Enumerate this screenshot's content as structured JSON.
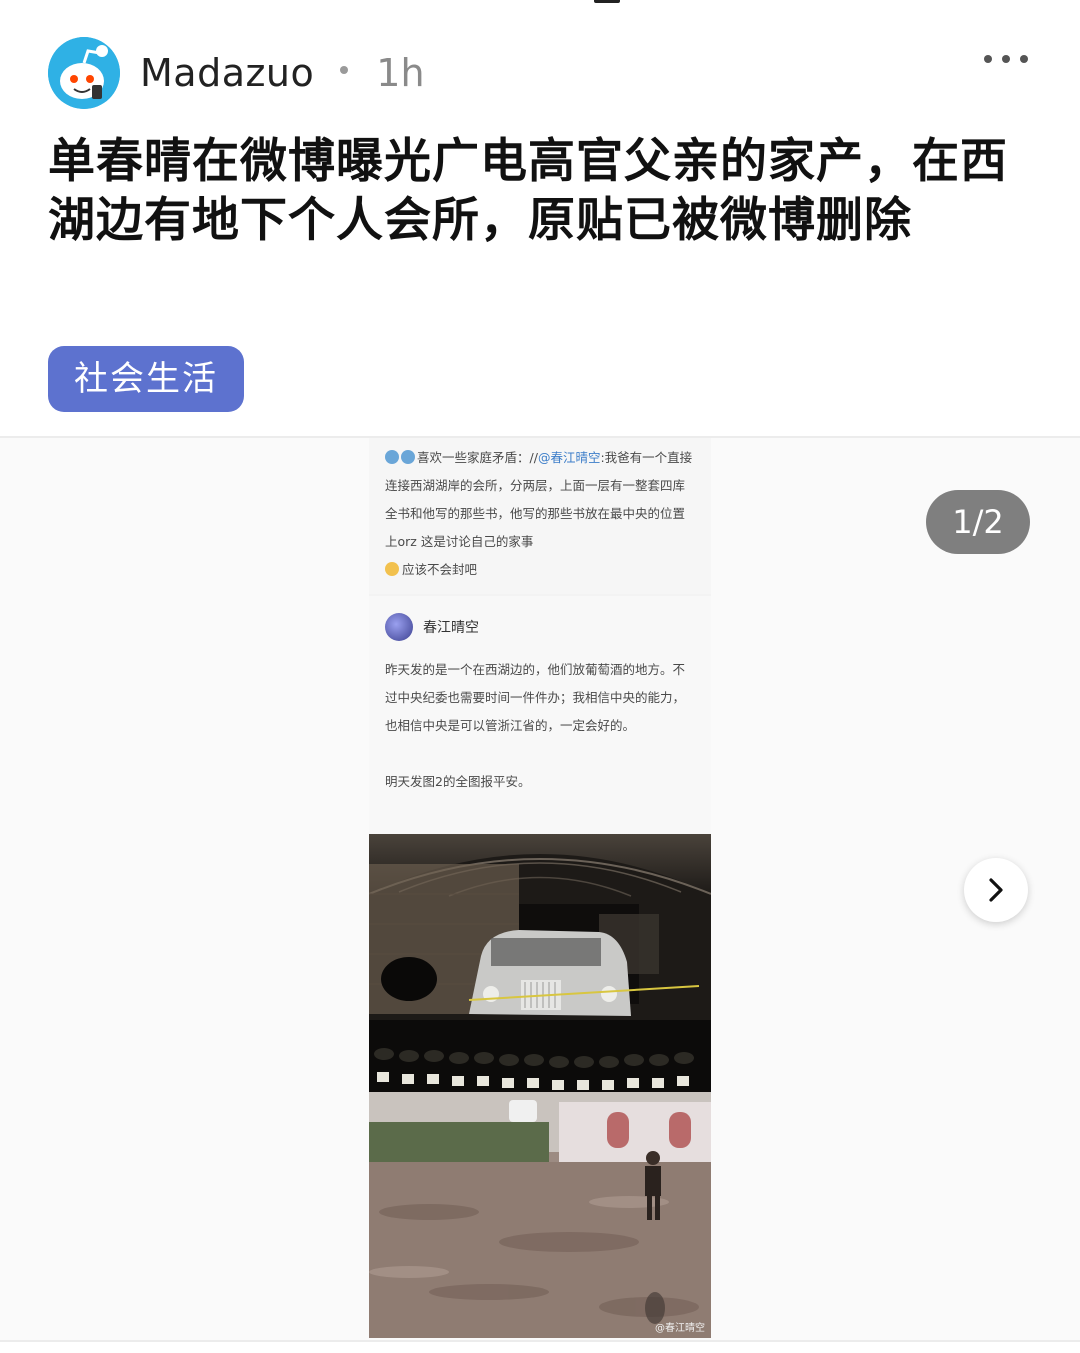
{
  "post": {
    "author": "Madazuo",
    "time": "1h",
    "title": "单春晴在微博曝光广电高官父亲的家产，在西湖边有地下个人会所，原贴已被微博删除",
    "flair": "社会生活",
    "colors": {
      "flair_bg": "#5d72cf",
      "avatar_bg": "#2fb1e5"
    }
  },
  "gallery": {
    "counter": "1/2",
    "icons": {
      "more": "more-dots-icon",
      "next": "chevron-right-icon"
    }
  },
  "image_content": {
    "repost_user": "喜欢一些家庭矛盾：",
    "repost_sep": "//",
    "repost_mention": "@春江晴空",
    "repost_body": ":我爸有一个直接连接西湖湖岸的会所，分两层，上面一层有一整套四库全书和他写的那些书，他写的那些书放在最中央的位置上orz 这是讨论自己的家事",
    "repost_tail": "应该不会封吧",
    "inner_author": "春江晴空",
    "inner_text": "昨天发的是一个在西湖边的，他们放葡萄酒的地方。不过中央纪委也需要时间一件件办；我相信中央的能力，也相信中央是可以管浙江省的，一定会好的。",
    "inner_text2": "明天发图2的全图报平安。",
    "watermark": "@春江晴空"
  }
}
